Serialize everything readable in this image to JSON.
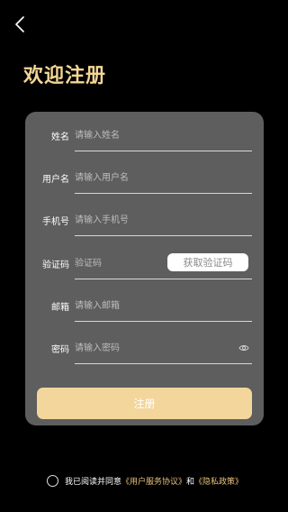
{
  "header": {
    "back_icon": "chevron-left-icon",
    "title": "欢迎注册"
  },
  "form": {
    "fields": [
      {
        "key": "name",
        "label": "姓名",
        "placeholder": "请输入姓名"
      },
      {
        "key": "username",
        "label": "用户名",
        "placeholder": "请输入用户名"
      },
      {
        "key": "phone",
        "label": "手机号",
        "placeholder": "请输入手机号"
      },
      {
        "key": "code",
        "label": "验证码",
        "placeholder": "验证码"
      },
      {
        "key": "email",
        "label": "邮箱",
        "placeholder": "请输入邮箱"
      },
      {
        "key": "password",
        "label": "密码",
        "placeholder": "请输入密码"
      }
    ],
    "get_code_label": "获取验证码",
    "password_toggle_icon": "eye-icon",
    "submit_label": "注册"
  },
  "agreement": {
    "prefix": "我已阅读并同意",
    "user_agreement": "《用户服务协议》",
    "and": "和",
    "privacy_policy": "《隐私政策》"
  },
  "colors": {
    "background": "#000000",
    "card": "#5e5e5e",
    "accent": "#f3d694",
    "button": "#f3d69c"
  }
}
